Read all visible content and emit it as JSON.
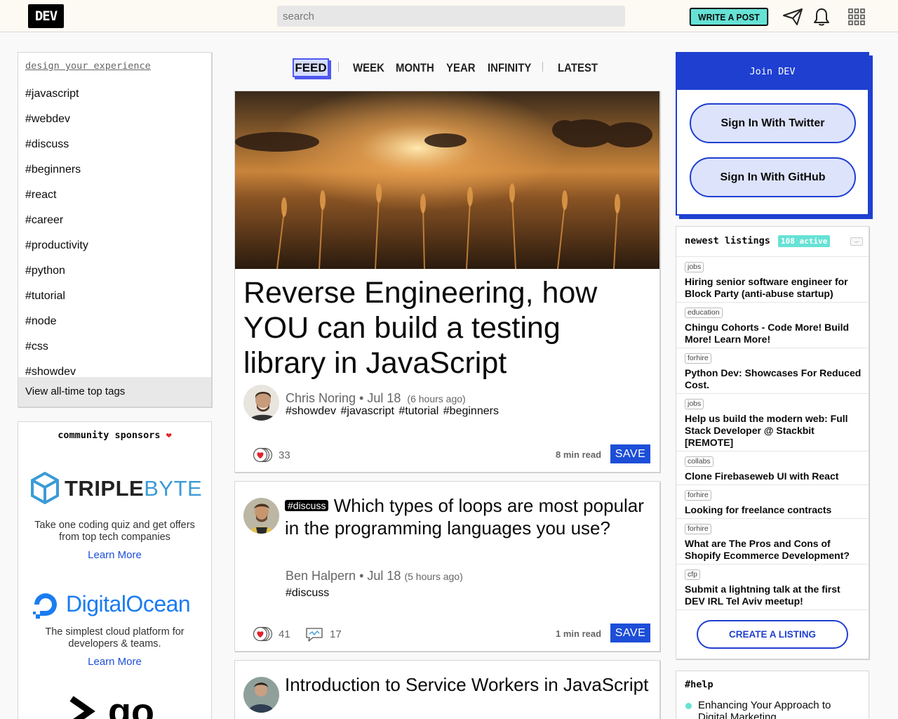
{
  "nav": {
    "logo": "DEV",
    "search_placeholder": "search",
    "write_post": "WRITE A POST",
    "icons": [
      "paper-plane-icon",
      "bell-icon",
      "grid-menu-icon"
    ]
  },
  "sidebar": {
    "design_link": "design your experience",
    "tags": [
      "#javascript",
      "#webdev",
      "#discuss",
      "#beginners",
      "#react",
      "#career",
      "#productivity",
      "#python",
      "#tutorial",
      "#node",
      "#css",
      "#showdev"
    ],
    "all_tags": "View all-time top tags"
  },
  "sponsors": {
    "title": "community sponsors",
    "heart": "❤️",
    "items": [
      {
        "name_a": "TRIPLE",
        "name_b": "BYTE",
        "desc": "Take one coding quiz and get offers from top tech companies",
        "link": "Learn More"
      },
      {
        "name": "DigitalOcean",
        "desc": "The simplest cloud platform for developers & teams.",
        "link": "Learn More"
      },
      {
        "name": "go"
      }
    ]
  },
  "tabs": {
    "active": "FEED",
    "items": [
      "WEEK",
      "MONTH",
      "YEAR",
      "INFINITY",
      "LATEST"
    ]
  },
  "colors": {
    "accent_blue": "#1f3fd1",
    "teal": "#66e2d5",
    "link_blue": "#1d4ed8"
  },
  "feed": {
    "featured": {
      "title": "Reverse Engineering, how YOU can build a testing library in JavaScript",
      "author": "Chris Noring",
      "date": "Jul 18",
      "ago": "(6 hours ago)",
      "tags": "#showdev  #javascript  #tutorial  #beginners",
      "reactions": "33",
      "read_time": "8 min read",
      "save": "SAVE"
    },
    "post2": {
      "tag_pill": "#discuss",
      "title": "Which types of loops are most popular in the programming languages you use?",
      "author": "Ben Halpern",
      "date": "Jul 18",
      "ago": "(5 hours ago)",
      "tags": "#discuss",
      "reactions": "41",
      "comments": "17",
      "read_time": "1 min read",
      "save": "SAVE"
    },
    "post3": {
      "title": "Introduction to Service Workers in JavaScript"
    }
  },
  "join": {
    "title": "Join DEV",
    "twitter": "Sign In With Twitter",
    "github": "Sign In With GitHub"
  },
  "listings": {
    "title": "newest listings",
    "badge": "108 active",
    "collapse": "–",
    "items": [
      {
        "category": "jobs",
        "title": "Hiring senior software engineer for Block Party (anti-abuse startup)"
      },
      {
        "category": "education",
        "title": "Chingu Cohorts - Code More! Build More! Learn More!"
      },
      {
        "category": "forhire",
        "title": "Python Dev: Showcases For Reduced Cost."
      },
      {
        "category": "jobs",
        "title": "Help us build the modern web: Full Stack Developer @ Stackbit [REMOTE]"
      },
      {
        "category": "collabs",
        "title": "Clone Firebaseweb UI with React"
      },
      {
        "category": "forhire",
        "title": "Looking for freelance contracts"
      },
      {
        "category": "forhire",
        "title": "What are The Pros and Cons of Shopify Ecommerce Development?"
      },
      {
        "category": "cfp",
        "title": "Submit a lightning talk at the first DEV IRL Tel Aviv meetup!"
      }
    ],
    "create": "CREATE A LISTING"
  },
  "help": {
    "title": "#help",
    "item": "Enhancing Your Approach to Digital Marketing"
  }
}
